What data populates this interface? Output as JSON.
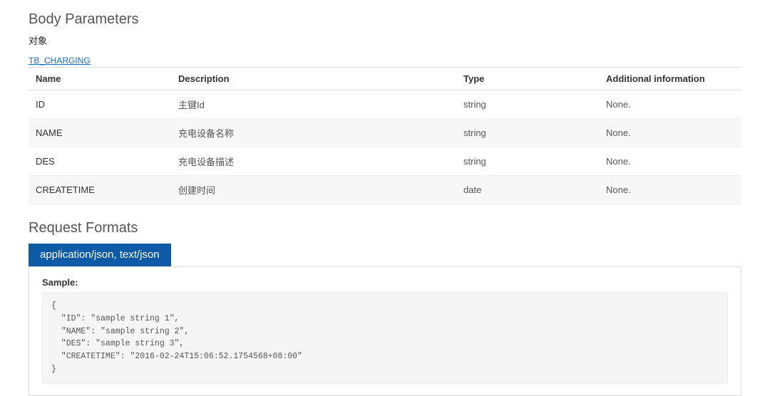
{
  "body_parameters": {
    "title": "Body Parameters",
    "subtitle": "对象",
    "model_link": "TB_CHARGING",
    "columns": {
      "name": "Name",
      "description": "Description",
      "type": "Type",
      "additional": "Additional information"
    },
    "rows": [
      {
        "name": "ID",
        "description": "主键Id",
        "type": "string",
        "additional": "None."
      },
      {
        "name": "NAME",
        "description": "充电设备名称",
        "type": "string",
        "additional": "None."
      },
      {
        "name": "DES",
        "description": "充电设备描述",
        "type": "string",
        "additional": "None."
      },
      {
        "name": "CREATETIME",
        "description": "创建时间",
        "type": "date",
        "additional": "None."
      }
    ]
  },
  "request_formats": {
    "title": "Request Formats",
    "tab_label": "application/json, text/json",
    "sample_label": "Sample:",
    "sample_code": "{\n  \"ID\": \"sample string 1\",\n  \"NAME\": \"sample string 2\",\n  \"DES\": \"sample string 3\",\n  \"CREATETIME\": \"2016-02-24T15:06:52.1754568+08:00\"\n}"
  }
}
